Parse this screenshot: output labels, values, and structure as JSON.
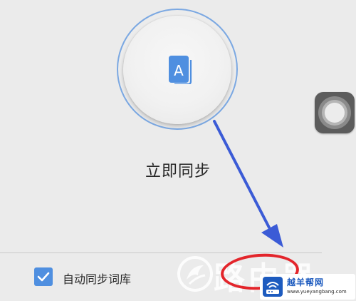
{
  "sync": {
    "button_label": "立即同步",
    "icon": "book-a-icon",
    "icon_letter": "A"
  },
  "options": {
    "auto_sync_label": "自动同步词库",
    "auto_sync_checked": true
  },
  "floating": {
    "icon": "assistive-touch-icon"
  },
  "annotation": {
    "arrow_color": "#3b5bd6",
    "highlight_color": "#e3252b"
  },
  "watermark": {
    "text": "路由器",
    "brand": "越羊帮网",
    "url": "www.yueyangbang.com"
  },
  "colors": {
    "accent": "#4f8fe0",
    "ring": "#7ba8e2",
    "background": "#ebebeb"
  }
}
